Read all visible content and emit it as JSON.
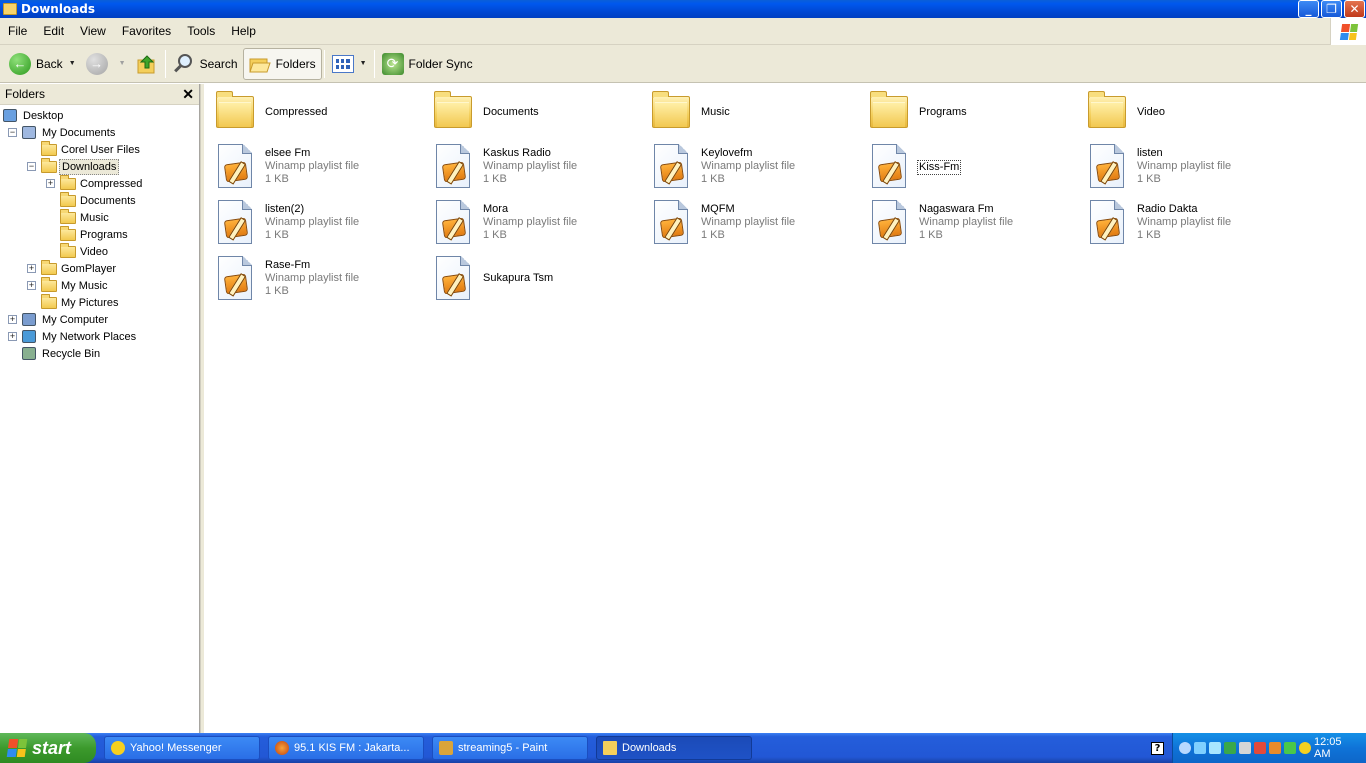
{
  "window": {
    "title": "Downloads"
  },
  "menu": [
    "File",
    "Edit",
    "View",
    "Favorites",
    "Tools",
    "Help"
  ],
  "toolbar": {
    "back": "Back",
    "search": "Search",
    "folders": "Folders",
    "sync": "Folder Sync"
  },
  "folder_pane": {
    "title": "Folders",
    "tree": [
      {
        "label": "Desktop",
        "icon": "desktop-icon"
      },
      {
        "label": "My Documents",
        "icon": "my-documents-icon"
      },
      {
        "label": "Corel User Files",
        "icon": "folder-icon"
      },
      {
        "label": "Downloads",
        "icon": "folder-open-icon",
        "selected": true
      },
      {
        "label": "Compressed",
        "icon": "folder-icon"
      },
      {
        "label": "Documents",
        "icon": "folder-icon"
      },
      {
        "label": "Music",
        "icon": "folder-icon"
      },
      {
        "label": "Programs",
        "icon": "folder-icon"
      },
      {
        "label": "Video",
        "icon": "folder-icon"
      },
      {
        "label": "GomPlayer",
        "icon": "folder-icon"
      },
      {
        "label": "My Music",
        "icon": "music-folder-icon"
      },
      {
        "label": "My Pictures",
        "icon": "pictures-folder-icon"
      },
      {
        "label": "My Computer",
        "icon": "computer-icon"
      },
      {
        "label": "My Network Places",
        "icon": "network-icon"
      },
      {
        "label": "Recycle Bin",
        "icon": "recycle-bin-icon"
      }
    ]
  },
  "items": [
    {
      "name": "Compressed",
      "type": "folder"
    },
    {
      "name": "Documents",
      "type": "folder"
    },
    {
      "name": "Music",
      "type": "folder"
    },
    {
      "name": "Programs",
      "type": "folder"
    },
    {
      "name": "Video",
      "type": "folder"
    },
    {
      "name": "elsee Fm",
      "type": "Winamp playlist file",
      "size": "1 KB"
    },
    {
      "name": "Kaskus Radio",
      "type": "Winamp playlist file",
      "size": "1 KB"
    },
    {
      "name": "Keylovefm",
      "type": "Winamp playlist file",
      "size": "1 KB"
    },
    {
      "name": "Kiss-Fm",
      "type": "",
      "size": "",
      "selected": true
    },
    {
      "name": "listen",
      "type": "Winamp playlist file",
      "size": "1 KB"
    },
    {
      "name": "listen(2)",
      "type": "Winamp playlist file",
      "size": "1 KB"
    },
    {
      "name": "Mora",
      "type": "Winamp playlist file",
      "size": "1 KB"
    },
    {
      "name": "MQFM",
      "type": "Winamp playlist file",
      "size": "1 KB"
    },
    {
      "name": "Nagaswara Fm",
      "type": "Winamp playlist file",
      "size": "1 KB"
    },
    {
      "name": "Radio Dakta",
      "type": "Winamp playlist file",
      "size": "1 KB"
    },
    {
      "name": "Rase-Fm",
      "type": "Winamp playlist file",
      "size": "1 KB"
    },
    {
      "name": "Sukapura Tsm",
      "type": "",
      "size": ""
    }
  ],
  "taskbar": {
    "start": "start",
    "buttons": [
      {
        "label": "Yahoo! Messenger",
        "icon": "yahoo-icon"
      },
      {
        "label": "95.1 KIS FM : Jakarta...",
        "icon": "firefox-icon"
      },
      {
        "label": "streaming5 - Paint",
        "icon": "paint-icon"
      },
      {
        "label": "Downloads",
        "icon": "folder-icon",
        "active": true
      }
    ],
    "clock": "12:05 AM"
  },
  "colors": {
    "titlebar": "#0058ee",
    "chrome": "#ece9d8",
    "taskbar": "#245edb",
    "start": "#3c9a2c"
  }
}
